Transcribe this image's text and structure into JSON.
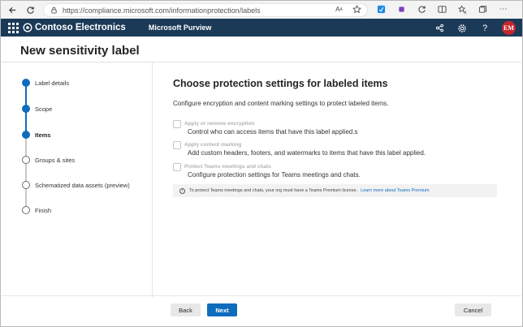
{
  "browser": {
    "url": "https://compliance.microsoft.com/informationprotection/labels"
  },
  "header": {
    "brand": "Contoso Electronics",
    "app_name": "Microsoft Purview",
    "avatar_initials": "EM"
  },
  "page": {
    "title": "New sensitivity label"
  },
  "stepper": {
    "steps": [
      {
        "label": "Label details",
        "state": "done"
      },
      {
        "label": "Scope",
        "state": "done"
      },
      {
        "label": "Items",
        "state": "current"
      },
      {
        "label": "Groups & sites",
        "state": "pending"
      },
      {
        "label": "Schematized data assets (preview)",
        "state": "pending"
      },
      {
        "label": "Finish",
        "state": "pending"
      }
    ]
  },
  "main": {
    "title": "Choose protection settings for labeled items",
    "description": "Configure encryption and content marking settings to protect labeled items.",
    "options": [
      {
        "title": "Apply or remove encryption",
        "description": "Control who can access items that have this label applied.s",
        "checked": false
      },
      {
        "title": "Apply content marking",
        "description": "Add custom headers, footers, and watermarks to items that have this label applied.",
        "checked": false
      },
      {
        "title": "Protect Teams meetings and chats",
        "description": "Configure protection settings for Teams meetings and chats.",
        "checked": false
      }
    ],
    "info": {
      "text": "To protect Teams meetings and chats, your org must have a Teams Premium license.",
      "link": "Learn more about Teams Premium"
    }
  },
  "footer": {
    "back": "Back",
    "next": "Next",
    "cancel": "Cancel"
  },
  "colors": {
    "header_bg": "#1b3a57",
    "accent": "#0f6cbd",
    "avatar_bg": "#c4262e"
  }
}
